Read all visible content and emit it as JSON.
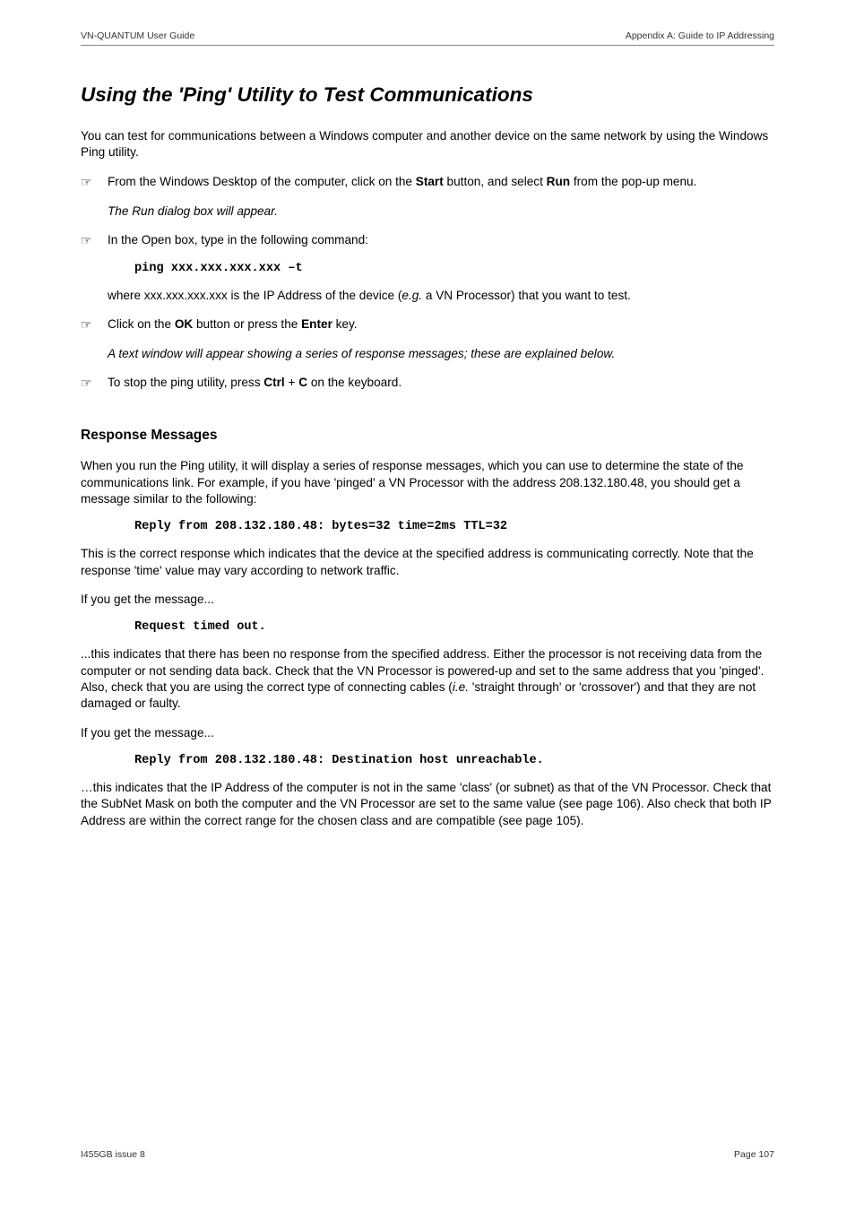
{
  "header": {
    "left": "VN-QUANTUM User Guide",
    "right": "Appendix A: Guide to IP Addressing"
  },
  "title": "Using the 'Ping' Utility to Test Communications",
  "intro": "You can test for communications between a Windows computer and another device on the same network by using the Windows Ping utility.",
  "step1_pre": "From the Windows Desktop of the computer, click on the ",
  "step1_b1": "Start",
  "step1_mid": " button, and select ",
  "step1_b2": "Run",
  "step1_post": " from the pop-up menu.",
  "step1_result": "The Run dialog box will appear.",
  "step2": "In the Open box, type in the following command:",
  "ping_cmd": "ping xxx.xxx.xxx.xxx –t",
  "where_pre": "where xxx.xxx.xxx.xxx is the IP Address of the device (",
  "where_eg": "e.g.",
  "where_post": " a VN Processor) that you want to test.",
  "step3_pre": "Click on the ",
  "step3_b1": "OK",
  "step3_mid": " button or press the ",
  "step3_b2": "Enter",
  "step3_post": " key.",
  "step3_result": "A text window will appear showing a series of response messages; these are explained below.",
  "step4_pre": "To stop the ping utility, press ",
  "step4_b1": "Ctrl",
  "step4_plus": " + ",
  "step4_b2": "C",
  "step4_post": " on the keyboard.",
  "resp_heading": "Response Messages",
  "resp_intro": "When you run the Ping utility, it will display a series of response messages, which you can use to determine the state of the communications link. For example, if you have 'pinged' a VN Processor with the address 208.132.180.48, you should get a message similar to the following:",
  "reply1": "Reply from 208.132.180.48: bytes=32 time=2ms TTL=32",
  "resp_correct": "This is the correct response which indicates that the device at the specified address is communicating correctly. Note that the response 'time' value may vary according to network traffic.",
  "if_msg1": "If you get the message...",
  "request_timed": "Request timed out.",
  "timed_para_pre": "...this indicates that there has been no response from the specified address. Either the processor is not receiving data from the computer or not sending data back. Check that the VN Processor is powered-up and set to the same address that you 'pinged'. Also, check that you are using the correct type of connecting cables (",
  "timed_para_ie": "i.e.",
  "timed_para_post": " 'straight through' or 'crossover') and that they are not damaged or faulty.",
  "if_msg2": "If you get the message...",
  "reply2": "Reply from 208.132.180.48: Destination host unreachable.",
  "unreach_para": "…this indicates that the IP Address of the computer is not in the same 'class' (or subnet) as that of the VN Processor. Check that the SubNet Mask on both the computer and the VN Processor are set to the same value (see page 106). Also check that both IP Address are within the correct range for the chosen class and are compatible (see page 105).",
  "footer": {
    "left": "I455GB issue 8",
    "right": "Page 107"
  }
}
